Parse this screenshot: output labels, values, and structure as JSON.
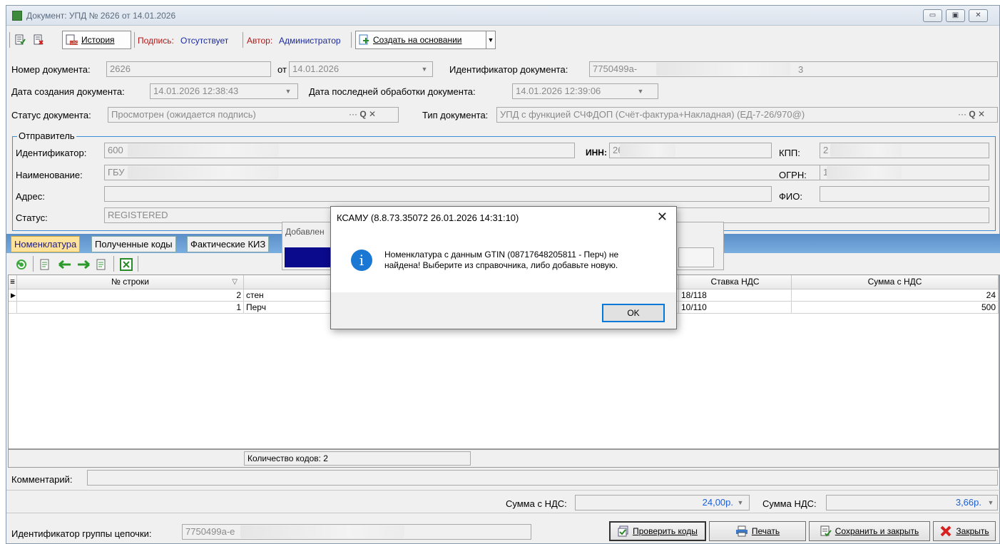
{
  "window": {
    "title": "Документ: УПД № 2626 от 14.01.2026"
  },
  "toolbar": {
    "history": "История",
    "signature_label": "Подпись:",
    "signature_value": "Отсутствует",
    "author_label": "Автор:",
    "author_value": "Администратор",
    "create_based": "Создать на основании"
  },
  "doc": {
    "number_label": "Номер документа:",
    "number": "2626",
    "date_label": "от",
    "date": "14.01.2026",
    "id_label": "Идентификатор документа:",
    "id": "7750499a-",
    "id_suffix": "3",
    "created_label": "Дата создания документа:",
    "created": "14.01.2026 12:38:43",
    "processed_label": "Дата последней обработки документа:",
    "processed": "14.01.2026 12:39:06",
    "status_label": "Статус документа:",
    "status": "Просмотрен (ожидается подпись)",
    "type_label": "Тип документа:",
    "type": "УПД с функцией СЧФДОП (Счёт-фактура+Накладная) (ЕД-7-26/970@)"
  },
  "sender": {
    "title": "Отправитель",
    "id_label": "Идентификатор:",
    "id": "600",
    "inn_label": "ИНН:",
    "inn": "26:",
    "kpp_label": "КПП:",
    "kpp": "2",
    "name_label": "Наименование:",
    "name": "ГБУ",
    "ogrn_label": "ОГРН:",
    "ogrn": "1",
    "address_label": "Адрес:",
    "address": "",
    "fio_label": "ФИО:",
    "fio": "",
    "status_label": "Статус:",
    "status": "REGISTERED"
  },
  "tabs": [
    "Номенклатура",
    "Полученные коды",
    "Фактические КИЗ"
  ],
  "grid": {
    "columns": [
      "№ строки",
      "Н",
      "Ставка НДС",
      "Сумма с НДС"
    ],
    "rows": [
      {
        "num": "2",
        "name": "стен",
        "vat": "18/118",
        "sum": "24"
      },
      {
        "num": "1",
        "name": "Перч",
        "vat": "10/110",
        "sum": "500"
      }
    ],
    "footer": "Количество кодов: 2"
  },
  "comment_label": "Комментарий:",
  "totals": {
    "sum_label": "Сумма с НДС:",
    "sum": "24,00р.",
    "vat_label": "Сумма НДС:",
    "vat": "3,66р."
  },
  "chain": {
    "label": "Идентификатор группы цепочки:",
    "value": "7750499a-e"
  },
  "buttons": {
    "check": "Проверить коды",
    "print": "Печать",
    "save_close": "Сохранить и закрыть",
    "close": "Закрыть"
  },
  "behind_label": "Добавлен",
  "dialog": {
    "title": "КСАМУ (8.8.73.35072 26.01.2026 14:31:10)",
    "line1": "Номенклатура с данным GTIN (08717648205811 - Перч) не",
    "line2": "найдена! Выберите из справочника, либо добавьте новую.",
    "ok": "OK"
  }
}
